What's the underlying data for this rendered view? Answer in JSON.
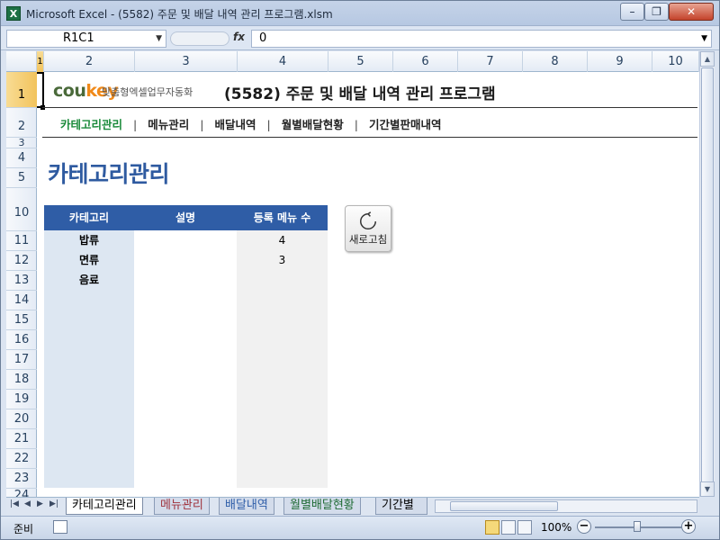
{
  "window": {
    "title": "Microsoft Excel - (5582) 주문 및 배달 내역 관리 프로그램.xlsm",
    "app_icon": "X",
    "controls": {
      "minimize": "–",
      "restore": "❐",
      "close": "✕"
    }
  },
  "formula_bar": {
    "name_box": "R1C1",
    "fx": "fx",
    "value": "0"
  },
  "columns": [
    "1",
    "2",
    "3",
    "4",
    "5",
    "6",
    "7",
    "8",
    "9",
    "10"
  ],
  "rows": [
    "1",
    "2",
    "3",
    "4",
    "5",
    "10",
    "11",
    "12",
    "13",
    "14",
    "15",
    "16",
    "17",
    "18",
    "19",
    "20",
    "21",
    "22",
    "23",
    "24"
  ],
  "header": {
    "logo_main": "cou",
    "logo_accent": "key",
    "logo_sub": "맞춤형엑셀업무자동화",
    "title": "(5582) 주문 및 배달 내역 관리 프로그램"
  },
  "nav": {
    "items": [
      "카테고리관리",
      "메뉴관리",
      "배달내역",
      "월별배달현황",
      "기간별판매내역"
    ],
    "separator": "|"
  },
  "page_title": "카테고리관리",
  "table": {
    "headers": [
      "카테고리",
      "설명",
      "등록 메뉴 수"
    ],
    "rows": [
      {
        "category": "밥류",
        "desc": "",
        "count": "4"
      },
      {
        "category": "면류",
        "desc": "",
        "count": "3"
      },
      {
        "category": "음료",
        "desc": "",
        "count": ""
      },
      {
        "category": "",
        "desc": "",
        "count": ""
      },
      {
        "category": "",
        "desc": "",
        "count": ""
      },
      {
        "category": "",
        "desc": "",
        "count": ""
      },
      {
        "category": "",
        "desc": "",
        "count": ""
      },
      {
        "category": "",
        "desc": "",
        "count": ""
      },
      {
        "category": "",
        "desc": "",
        "count": ""
      },
      {
        "category": "",
        "desc": "",
        "count": ""
      },
      {
        "category": "",
        "desc": "",
        "count": ""
      },
      {
        "category": "",
        "desc": "",
        "count": ""
      },
      {
        "category": "",
        "desc": "",
        "count": ""
      }
    ]
  },
  "refresh_button": {
    "label": "새로고침",
    "icon": "refresh-icon"
  },
  "sheet_tabs": [
    "카테고리관리",
    "메뉴관리",
    "배달내역",
    "월별배달현황",
    "기간별"
  ],
  "status": {
    "ready": "준비",
    "zoom": "100%"
  },
  "colors": {
    "accent_blue": "#2f5da6",
    "title_blue": "#2e5aa0",
    "nav_active": "#1a8a3a",
    "logo_orange": "#f08a1a"
  }
}
